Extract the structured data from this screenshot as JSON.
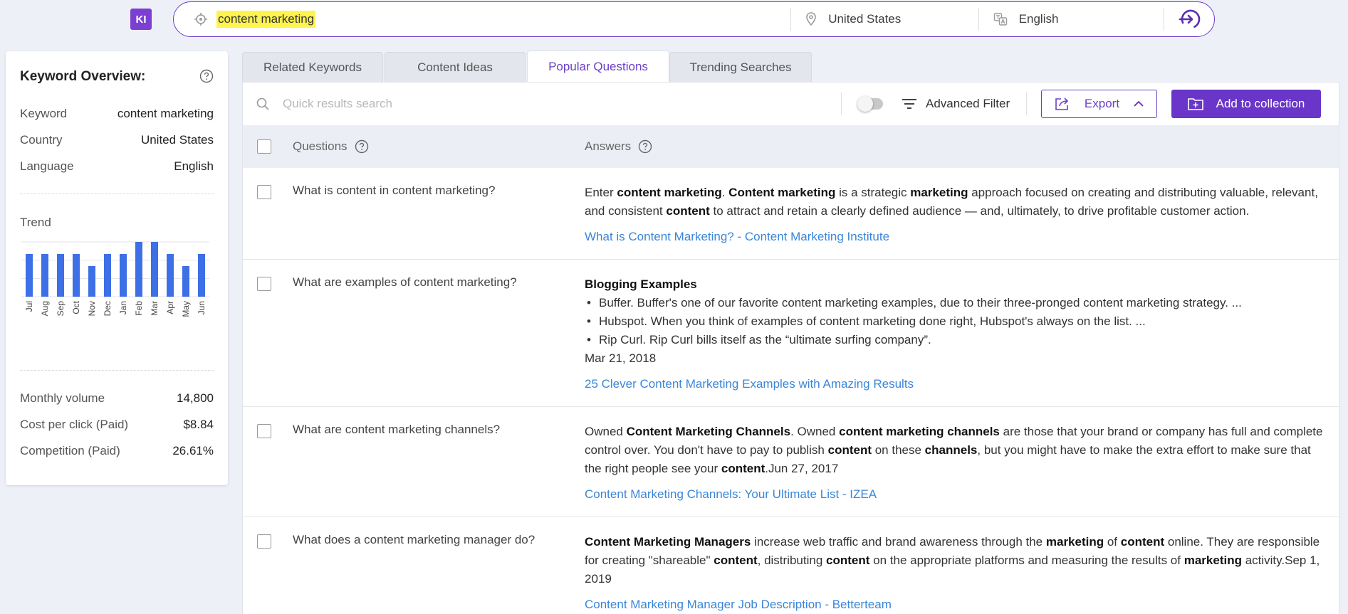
{
  "header": {
    "logo": "KI",
    "keyword": "content marketing",
    "country": "United States",
    "language": "English"
  },
  "overview": {
    "title": "Keyword Overview:",
    "rows": [
      {
        "label": "Keyword",
        "value": "content marketing"
      },
      {
        "label": "Country",
        "value": "United States"
      },
      {
        "label": "Language",
        "value": "English"
      }
    ],
    "trend_label": "Trend",
    "metrics": [
      {
        "label": "Monthly volume",
        "value": "14,800"
      },
      {
        "label": "Cost per click (Paid)",
        "value": "$8.84"
      },
      {
        "label": "Competition (Paid)",
        "value": "26.61%"
      }
    ]
  },
  "chart_data": {
    "type": "bar",
    "categories": [
      "Jul",
      "Aug",
      "Sep",
      "Oct",
      "Nov",
      "Dec",
      "Jan",
      "Feb",
      "Mar",
      "Apr",
      "May",
      "Jun"
    ],
    "values": [
      0.78,
      0.78,
      0.78,
      0.78,
      0.56,
      0.78,
      0.78,
      1.0,
      1.0,
      0.78,
      0.56,
      0.78
    ],
    "ylim": [
      0,
      1
    ],
    "color": "#3d6fe6",
    "grid": true
  },
  "tabs": [
    "Related Keywords",
    "Content Ideas",
    "Popular Questions",
    "Trending Searches"
  ],
  "active_tab": "Popular Questions",
  "toolbar": {
    "search_placeholder": "Quick results search",
    "advanced_filter": "Advanced Filter",
    "export": "Export",
    "add_to_collection": "Add to collection"
  },
  "table": {
    "col_questions": "Questions",
    "col_answers": "Answers",
    "rows": [
      {
        "question": "What is content in content marketing?",
        "link": "What is Content Marketing? - Content Marketing Institute"
      },
      {
        "question": "What are examples of content marketing?",
        "heading": "Blogging Examples",
        "bullets": [
          "Buffer. Buffer's one of our favorite content marketing examples, due to their three-pronged content marketing strategy. ...",
          "Hubspot. When you think of examples of content marketing done right, Hubspot's always on the list. ...",
          "Rip Curl. Rip Curl bills itself as the “ultimate surfing company”."
        ],
        "date": "Mar 21, 2018",
        "link": "25 Clever Content Marketing Examples with Amazing Results"
      },
      {
        "question": "What are content marketing channels?",
        "link": "Content Marketing Channels: Your Ultimate List - IZEA"
      },
      {
        "question": "What does a content marketing manager do?",
        "link": "Content Marketing Manager Job Description - Betterteam"
      }
    ]
  }
}
